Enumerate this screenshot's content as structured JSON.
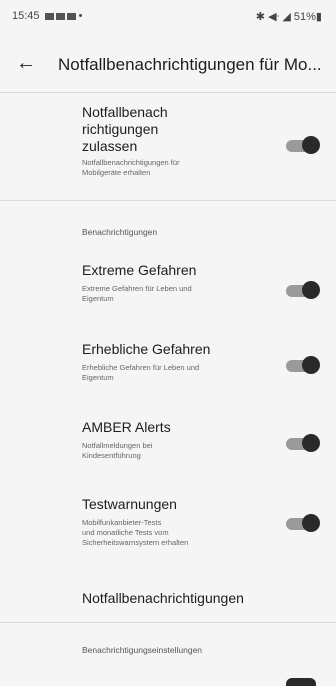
{
  "status_bar": {
    "time": "15:45",
    "dot": "•",
    "right": "✱ ◀ᐧ ◢ 51%▮"
  },
  "app_bar": {
    "title": "Notfallbenachrichtigungen für Mo..."
  },
  "master": {
    "title_lines": [
      "Notfallbenach",
      "richtigungen",
      "zulassen"
    ],
    "sub_lines": [
      "Notfallbenachrichtigungen für",
      "Mobilgeräte erhalten"
    ],
    "enabled": true
  },
  "section1_header": "Benachrichtigungen",
  "items": [
    {
      "title": "Extreme Gefahren",
      "sub_lines": [
        "Extreme Gefahren für Leben und",
        "Eigentum"
      ],
      "enabled": true
    },
    {
      "title": "Erhebliche Gefahren",
      "sub_lines": [
        "Erhebliche Gefahren für Leben und",
        "Eigentum"
      ],
      "enabled": true
    },
    {
      "title": "AMBER Alerts",
      "sub_lines": [
        "Notfallmeldungen bei",
        "Kindesentführung"
      ],
      "enabled": true
    },
    {
      "title": "Testwarnungen",
      "sub_lines": [
        "Mobilfunkanbieter-Tests",
        "und monatliche Tests vom",
        "Sicherheitswarnsystem erhalten"
      ],
      "enabled": true
    }
  ],
  "history_item": "Notfallbenachrichtigungen",
  "section2_header": "Benachrichtigungseinstellungen"
}
